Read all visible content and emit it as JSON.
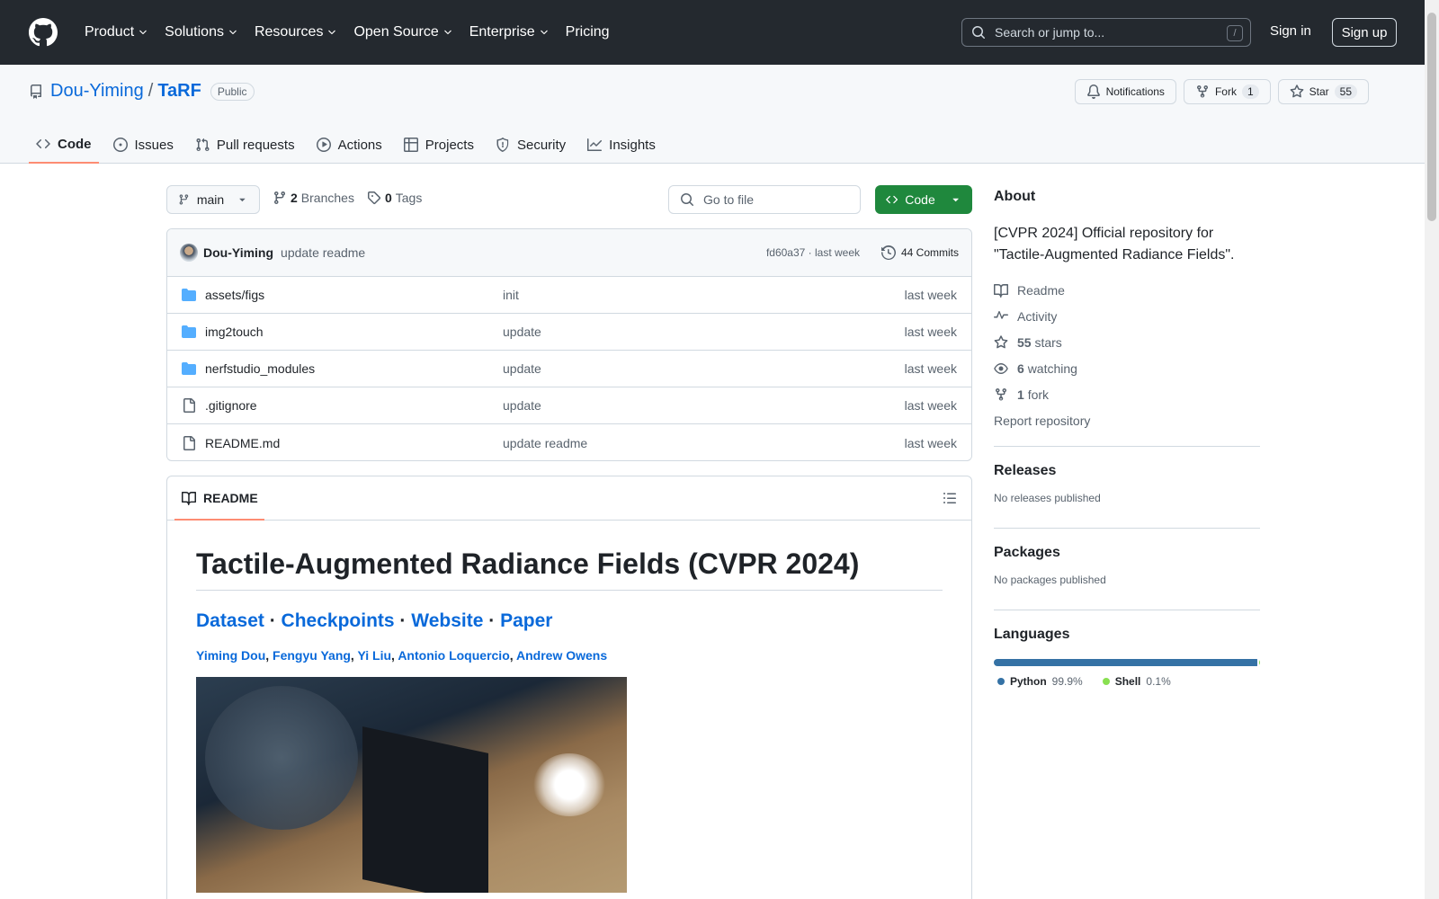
{
  "header": {
    "nav": [
      "Product",
      "Solutions",
      "Resources",
      "Open Source",
      "Enterprise",
      "Pricing"
    ],
    "search_placeholder": "Search or jump to...",
    "search_shortcut": "/",
    "signin": "Sign in",
    "signup": "Sign up"
  },
  "repo": {
    "owner": "Dou-Yiming",
    "separator": "/",
    "name": "TaRF",
    "visibility": "Public",
    "notifications_label": "Notifications",
    "fork_label": "Fork",
    "fork_count": "1",
    "star_label": "Star",
    "star_count": "55"
  },
  "tabs": [
    "Code",
    "Issues",
    "Pull requests",
    "Actions",
    "Projects",
    "Security",
    "Insights"
  ],
  "toolbar": {
    "branch": "main",
    "branches_count": "2",
    "branches_label": "Branches",
    "tags_count": "0",
    "tags_label": "Tags",
    "goto_placeholder": "Go to file",
    "code_label": "Code"
  },
  "commit": {
    "author": "Dou-Yiming",
    "message": "update readme",
    "sha_time": "fd60a37 · last week",
    "commits": "44 Commits"
  },
  "files": [
    {
      "name": "assets/figs",
      "type": "folder",
      "message": "init",
      "date": "last week"
    },
    {
      "name": "img2touch",
      "type": "folder",
      "message": "update",
      "date": "last week"
    },
    {
      "name": "nerfstudio_modules",
      "type": "folder",
      "message": "update",
      "date": "last week"
    },
    {
      "name": ".gitignore",
      "type": "file",
      "message": "update",
      "date": "last week"
    },
    {
      "name": "README.md",
      "type": "file",
      "message": "update readme",
      "date": "last week"
    }
  ],
  "readme": {
    "tab": "README",
    "title": "Tactile-Augmented Radiance Fields (CVPR 2024)",
    "links": [
      "Dataset",
      "Checkpoints",
      "Website",
      "Paper"
    ],
    "link_sep": " · ",
    "authors": [
      "Yiming Dou",
      "Fengyu Yang",
      "Yi Liu",
      "Antonio Loquercio",
      "Andrew Owens"
    ],
    "author_sep": ", "
  },
  "about": {
    "heading": "About",
    "description": "[CVPR 2024] Official repository for \"Tactile-Augmented Radiance Fields\".",
    "readme": "Readme",
    "activity": "Activity",
    "stars_count": "55",
    "stars_label": "stars",
    "watching_count": "6",
    "watching_label": "watching",
    "forks_count": "1",
    "forks_label": "fork",
    "report": "Report repository"
  },
  "releases": {
    "heading": "Releases",
    "text": "No releases published"
  },
  "packages": {
    "heading": "Packages",
    "text": "No packages published"
  },
  "languages": {
    "heading": "Languages",
    "items": [
      {
        "name": "Python",
        "percent": "99.9%",
        "share": 99.9,
        "color": "#3572A5"
      },
      {
        "name": "Shell",
        "percent": "0.1%",
        "share": 0.1,
        "color": "#89e051"
      }
    ]
  }
}
